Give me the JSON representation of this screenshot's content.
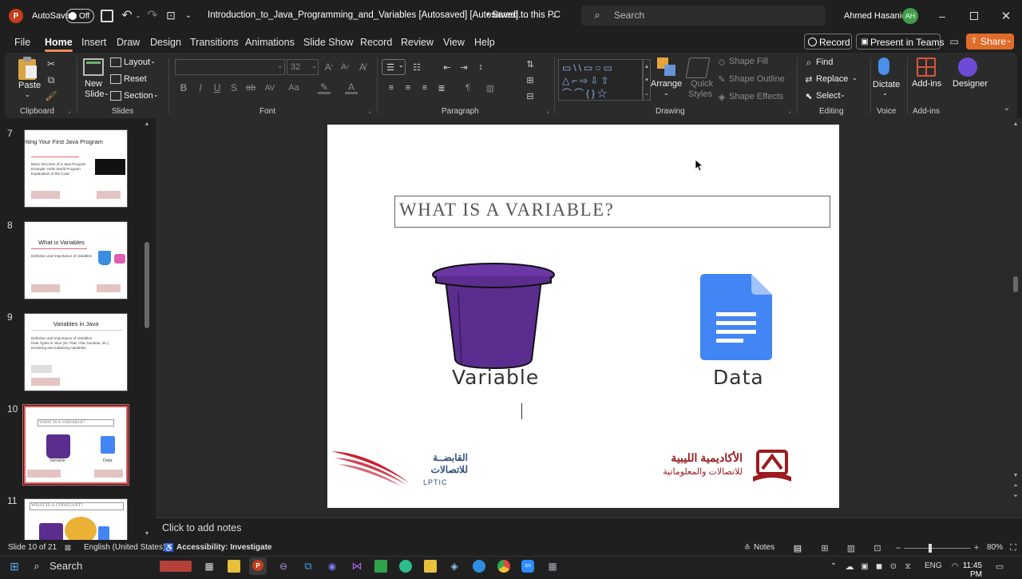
{
  "titlebar": {
    "autosave_label": "AutoSave",
    "autosave_state": "Off",
    "doc_title": "Introduction_to_Java_Programming_and_Variables [Autosaved] [Autosaved]....",
    "save_status": "• Saved to this PC",
    "search_placeholder": "Search",
    "user_name": "Ahmed Hasanien",
    "user_initials": "AH"
  },
  "menu": {
    "items": [
      "File",
      "Home",
      "Insert",
      "Draw",
      "Design",
      "Transitions",
      "Animations",
      "Slide Show",
      "Record",
      "Review",
      "View",
      "Help"
    ],
    "active": "Home",
    "record_button": "Record",
    "present_teams_button": "Present in Teams",
    "share_button": "Share"
  },
  "ribbon": {
    "clipboard": {
      "label": "Clipboard",
      "paste": "Paste"
    },
    "slides": {
      "label": "Slides",
      "new_slide": "New",
      "new_slide2": "Slide",
      "layout": "Layout",
      "reset": "Reset",
      "section": "Section"
    },
    "font": {
      "label": "Font",
      "font_name": "",
      "font_size": "32"
    },
    "paragraph": {
      "label": "Paragraph"
    },
    "drawing": {
      "label": "Drawing",
      "arrange": "Arrange",
      "quick_styles": "Quick",
      "quick_styles2": "Styles",
      "shape_fill": "Shape Fill",
      "shape_outline": "Shape Outline",
      "shape_effects": "Shape Effects"
    },
    "editing": {
      "label": "Editing",
      "find": "Find",
      "replace": "Replace",
      "select": "Select"
    },
    "voice": {
      "label": "Voice",
      "dictate": "Dictate"
    },
    "addins": {
      "label": "Add-ins",
      "addins": "Add-ins",
      "designer": "Designer"
    }
  },
  "thumbnails": [
    {
      "num": "7",
      "title": "Writing Your First Java Program",
      "bullets": [
        "Basic Structure of a Java Program",
        "Example: Hello World Program",
        "Explanation of the Code"
      ]
    },
    {
      "num": "8",
      "title": "What is Variables",
      "bullets": [
        "Definition and Importance of Variables"
      ]
    },
    {
      "num": "9",
      "title": "Variables in Java",
      "bullets": [
        "Definition and Importance of Variables",
        "Data Types in Java (int, float, char, boolean, etc.)",
        "Declaring and Initializing Variables"
      ]
    },
    {
      "num": "10",
      "title": "WHAT IS A VARIABLE?",
      "bullets": []
    },
    {
      "num": "11",
      "title": "WHAT IS A CONSTANT?",
      "bullets": []
    }
  ],
  "slide": {
    "title": "WHAT IS A VARIABLE?",
    "left_label": "Variable",
    "right_label": "Data",
    "logo_left_ar": "القابضــة للاتصالات",
    "logo_left_en": "LPTIC",
    "logo_right_ar1": "الأكاديمية الليبية",
    "logo_right_ar2": "للاتصالات والمعلوماتية"
  },
  "notes_placeholder": "Click to add notes",
  "status": {
    "slide_info": "Slide 10 of 21",
    "language": "English (United States)",
    "accessibility": "Accessibility: Investigate",
    "notes": "Notes",
    "zoom": "80%"
  },
  "taskbar": {
    "search": "Search",
    "lang": "ENG",
    "time": "11:45 PM"
  },
  "colors": {
    "accent": "#c43e1c",
    "share": "#e06c2b",
    "bucket": "#5b2d8e",
    "doc": "#4285f4"
  }
}
